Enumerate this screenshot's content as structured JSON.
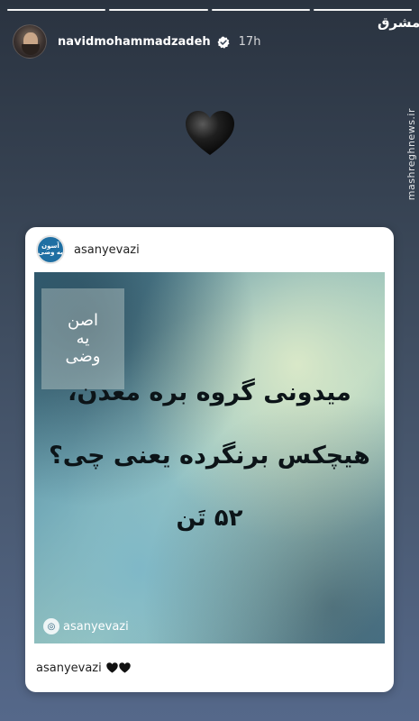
{
  "story": {
    "progress_total": 4,
    "progress_filled": 4,
    "username": "navidmohammadzadeh",
    "time": "17h",
    "verified": true
  },
  "watermark": {
    "logo": "مشرق",
    "site": "mashreghnews.ir"
  },
  "sticker": {
    "emoji": "black-heart-icon"
  },
  "post": {
    "username": "asanyevazi",
    "avatar_text": "آسون یه وضی",
    "image": {
      "logo_lines": [
        "اصن",
        "یه",
        "وضی"
      ],
      "line1": "میدونی گروه بره معدن،",
      "line2": "هیچکس برنگرده یعنی چی؟",
      "line3": "۵۲ تَن",
      "watermark": "asanyevazi"
    },
    "caption": {
      "username": "asanyevazi",
      "emoji": [
        "black-heart-icon",
        "black-heart-icon"
      ]
    }
  },
  "colors": {
    "background_top": "#2a3340",
    "background_bottom": "#55688a",
    "verified_blue": "#ffffff"
  }
}
